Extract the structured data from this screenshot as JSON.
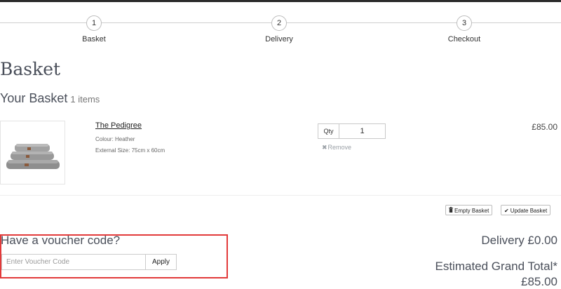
{
  "progress": {
    "steps": [
      {
        "number": "1",
        "label": "Basket"
      },
      {
        "number": "2",
        "label": "Delivery"
      },
      {
        "number": "3",
        "label": "Checkout"
      }
    ]
  },
  "page": {
    "title": "Basket",
    "basket_heading": "Your Basket",
    "item_count": "1 items"
  },
  "item": {
    "name": "The Pedigree",
    "colour": "Colour: Heather",
    "size": "External Size: 75cm x 60cm",
    "qty_label": "Qty",
    "qty_value": "1",
    "remove_label": "Remove",
    "price": "£85.00",
    "image_icon": "dog-bed-image"
  },
  "actions": {
    "empty_label": "Empty Basket",
    "update_label": "Update Basket",
    "empty_icon": "trash-icon",
    "update_icon": "check-icon"
  },
  "voucher": {
    "title": "Have a voucher code?",
    "placeholder": "Enter Voucher Code",
    "apply_label": "Apply",
    "highlight_color": "#e23a3a"
  },
  "totals": {
    "delivery": "Delivery £0.00",
    "grand_label": "Estimated Grand Total*",
    "grand_value": "£85.00"
  }
}
